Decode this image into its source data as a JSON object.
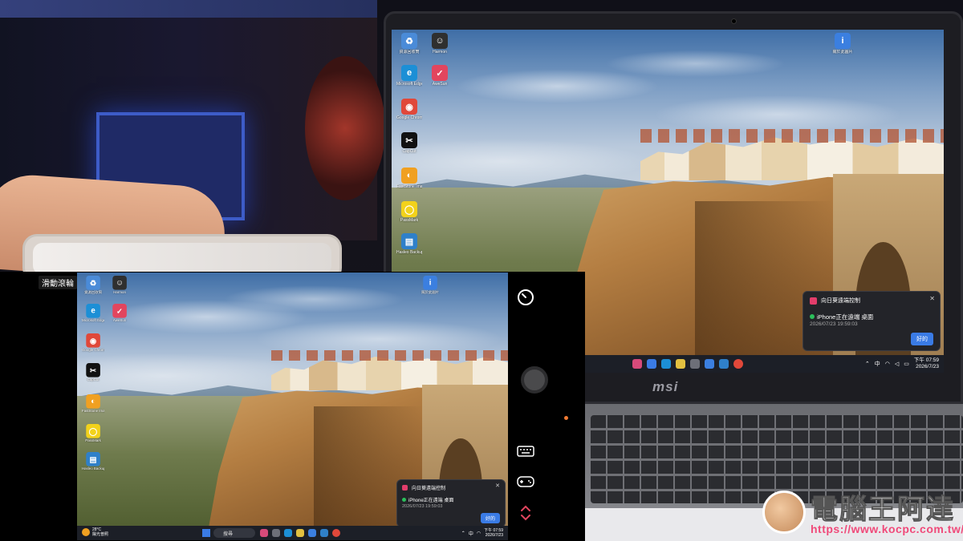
{
  "remote_app": {
    "mode_label": "滑動滾輪"
  },
  "desktop_icons": [
    {
      "label": "資源回收筒",
      "color": "#4a8bd8",
      "glyph": "♻"
    },
    {
      "label": "Harmon",
      "color": "#2f2f2f",
      "glyph": "☺"
    },
    {
      "label": "Microsoft Edge",
      "color": "#1c8fd6",
      "glyph": "e"
    },
    {
      "label": "AweSun",
      "color": "#e2455e",
      "glyph": "✓"
    },
    {
      "label": "Google Chrome",
      "color": "#e0483a",
      "glyph": "◉"
    },
    {
      "label": "CapCut",
      "color": "#111111",
      "glyph": "✂"
    },
    {
      "label": "FastStone Image Viewer",
      "color": "#f0a021",
      "glyph": "◐"
    },
    {
      "label": "PassMark",
      "color": "#f2d21b",
      "glyph": "◯"
    },
    {
      "label": "Hasleo Backup Suite",
      "color": "#2f80c9",
      "glyph": "▤"
    },
    {
      "label": "關於此圖片",
      "color": "#3b7fe0",
      "glyph": "i"
    }
  ],
  "toast": {
    "app_name": "向日葵遠端控制",
    "close": "✕",
    "message": "iPhone正在遠端 桌面",
    "timestamp": "2026/07/23 19:59:03",
    "button": "好的"
  },
  "laptop_taskbar": {
    "tray_ime": "中",
    "time": "下午 07:59",
    "date": "2026/7/23"
  },
  "remote_taskbar": {
    "weather_temp": "28°C",
    "weather_desc": "陽光普照",
    "search_placeholder": "搜尋",
    "tray_ime": "中",
    "time": "下午 07:59",
    "date": "2026/7/23"
  },
  "laptop_brand": "msi",
  "watermark": {
    "title": "電腦王阿達",
    "url": "https://www.kocpc.com.tw/"
  },
  "colors": {
    "accent": "#3a7be5",
    "toast_icon": "#e23d6b",
    "status_green": "#2bbf5b",
    "indicator_orange": "#f07a33"
  }
}
